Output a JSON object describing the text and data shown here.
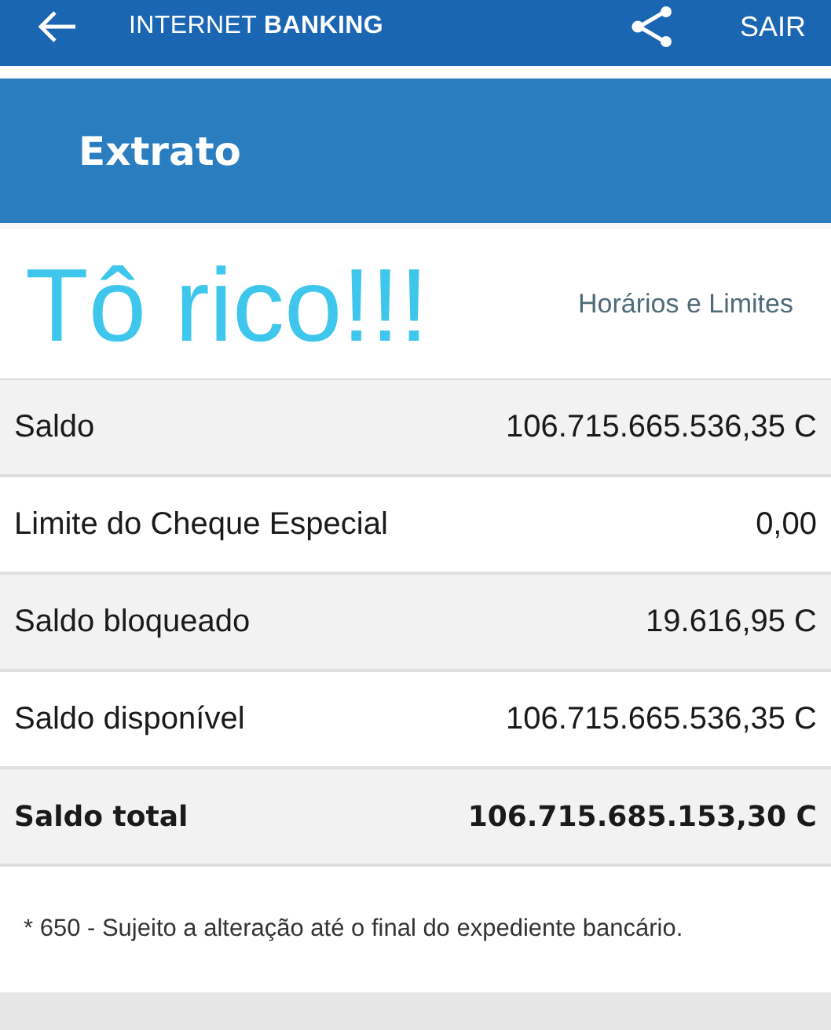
{
  "top_bar": {
    "brand_light": "INTERNET",
    "brand_bold": "BANKING",
    "exit": "SAIR"
  },
  "header": {
    "title": "Extrato"
  },
  "caption": "Tô rico!!!",
  "link": "Horários e Limites",
  "rows": [
    {
      "kind": "item",
      "label": "Saldo",
      "value": "106.715.665.536,35 C"
    },
    {
      "kind": "item",
      "label": "Limite do Cheque Especial",
      "value": "0,00"
    },
    {
      "kind": "item",
      "label": "Saldo bloqueado",
      "value": "19.616,95 C"
    },
    {
      "kind": "item",
      "label": "Saldo disponível",
      "value": "106.715.665.536,35 C"
    },
    {
      "kind": "total",
      "label": "Saldo total",
      "value": "106.715.685.153,30 C"
    }
  ],
  "footnote": "* 650 - Sujeito a alteração até o final do expediente bancário."
}
